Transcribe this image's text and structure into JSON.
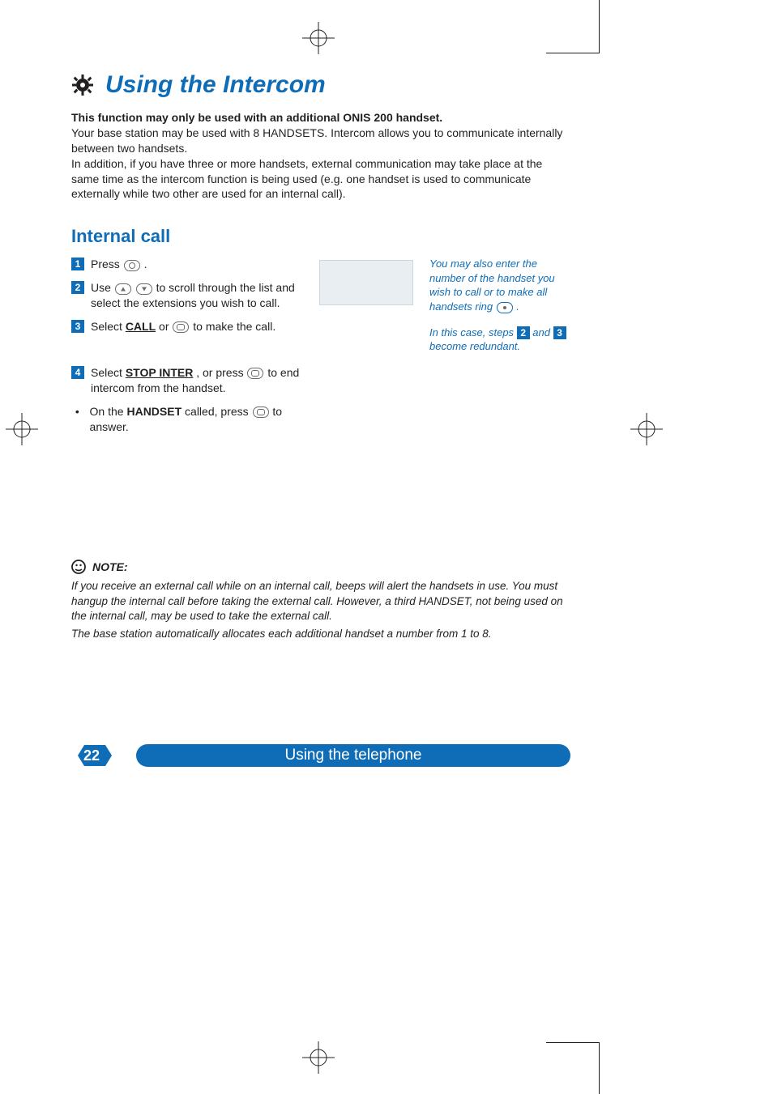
{
  "title": "Using the Intercom",
  "intro": {
    "bold_line": "This function may only be used with an additional ONIS 200 handset.",
    "line2": "Your base station may be used with 8 HANDSETS. Intercom allows you to communicate internally between two handsets.",
    "line3": "In addition, if you have three or more handsets, external communication may take place at the same time as the intercom function is being used (e.g. one handset is used to communicate externally while two other are used for an internal call)."
  },
  "section_heading": "Internal call",
  "steps": {
    "s1": {
      "num": "1",
      "a": "Press ",
      "b": " ."
    },
    "s2": {
      "num": "2",
      "a": "Use ",
      "b": " to scroll through the list and select the extensions you wish to call."
    },
    "s3": {
      "num": "3",
      "a": "Select ",
      "call_label": "CALL",
      "b": " or ",
      "c": " to make the call."
    },
    "s4": {
      "num": "4",
      "a": "Select ",
      "stop_label": "STOP INTER",
      "b": ", or press ",
      "c": " to end intercom from the handset."
    },
    "bullet": {
      "a": "On the ",
      "handset": "HANDSET",
      "b": " called, press ",
      "c": " to answer."
    }
  },
  "sidebar": {
    "p1": "You may also enter the number of the handset you wish to call or to make all handsets ring ",
    "p1_end": " .",
    "p2a": "In this case, steps ",
    "n2": "2",
    "p2b": " and ",
    "n3": "3",
    "p2c": " become redundant."
  },
  "note": {
    "heading": "NOTE:",
    "p1": "If you receive an external call while on an internal call, beeps will alert the handsets in use. You must hangup the internal call before taking the external call. However, a third HANDSET, not being used on the internal call, may be used to take the external call.",
    "p2": "The base station automatically allocates each additional handset a number from 1 to 8."
  },
  "footer": {
    "page_number": "22",
    "bar_label": "Using the telephone"
  }
}
